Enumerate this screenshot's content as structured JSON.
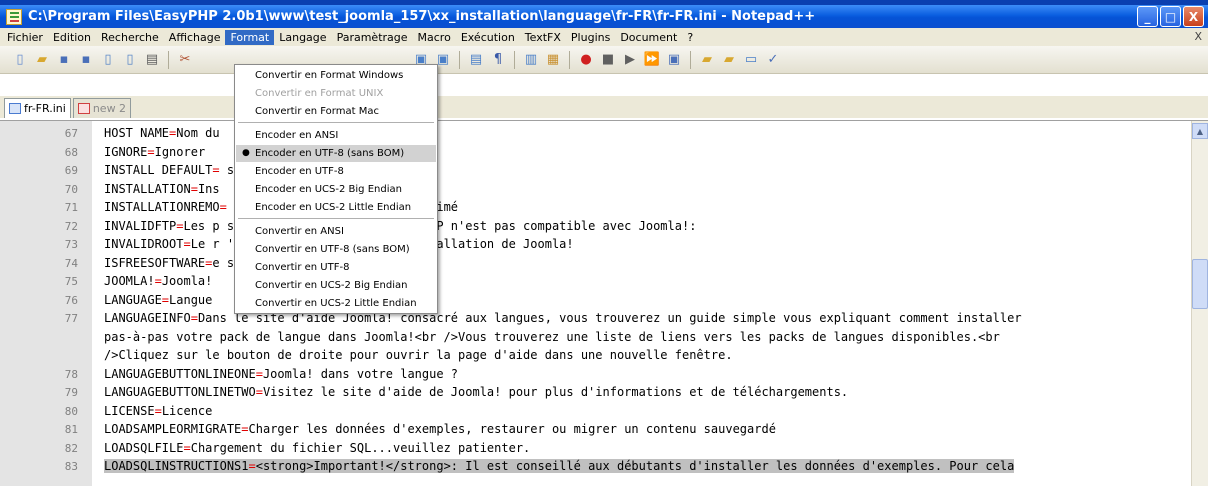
{
  "window": {
    "title": "C:\\Program Files\\EasyPHP 2.0b1\\www\\test_joomla_157\\xx_installation\\language\\fr-FR\\fr-FR.ini - Notepad++",
    "minimize_glyph": "_",
    "maximize_glyph": "□",
    "close_glyph": "X"
  },
  "menubar": {
    "items": [
      "Fichier",
      "Edition",
      "Recherche",
      "Affichage",
      "Format",
      "Langage",
      "Paramètrage",
      "Macro",
      "Exécution",
      "TextFX",
      "Plugins",
      "Document",
      "?"
    ],
    "active": "Format",
    "close_doc": "X"
  },
  "tabs": [
    {
      "label": "fr-FR.ini",
      "active": true
    },
    {
      "label": "new 2",
      "active": false
    }
  ],
  "format_menu": {
    "items": [
      {
        "label": "Convertir en Format Windows",
        "state": "normal"
      },
      {
        "label": "Convertir en Format UNIX",
        "state": "disabled"
      },
      {
        "label": "Convertir en Format Mac",
        "state": "normal"
      },
      {
        "label": "Encoder en ANSI",
        "state": "normal"
      },
      {
        "label": "Encoder en UTF-8 (sans BOM)",
        "state": "checked"
      },
      {
        "label": "Encoder en UTF-8",
        "state": "normal"
      },
      {
        "label": "Encoder en UCS-2 Big Endian",
        "state": "normal"
      },
      {
        "label": "Encoder en UCS-2 Little Endian",
        "state": "normal"
      },
      {
        "label": "Convertir en ANSI",
        "state": "normal"
      },
      {
        "label": "Convertir en UTF-8 (sans BOM)",
        "state": "normal"
      },
      {
        "label": "Convertir en UTF-8",
        "state": "normal"
      },
      {
        "label": "Convertir en UCS-2 Big Endian",
        "state": "normal"
      },
      {
        "label": "Convertir en UCS-2 Little Endian",
        "state": "normal"
      }
    ]
  },
  "editor": {
    "lines": [
      {
        "num": "67",
        "key": "HOST NAME",
        "value": "Nom du"
      },
      {
        "num": "68",
        "key": "IGNORE",
        "value": "Ignorer"
      },
      {
        "num": "69",
        "key": "INSTALL DEFAULT",
        "value": "                     s données d'exemples"
      },
      {
        "num": "70",
        "key": "INSTALLATION",
        "value": "Ins"
      },
      {
        "num": "71",
        "key": "INSTALLATIONREMO",
        "value": "                     le répertoire aura été supprimé"
      },
      {
        "num": "72",
        "key": "INVALIDFTP",
        "value": "Les p                     s valides ou votre serveur FTP n'est pas compatible avec Joomla!:"
      },
      {
        "num": "73",
        "key": "INVALIDROOT",
        "value": "Le r                      'est pas le répertoire d'installation de Joomla!"
      },
      {
        "num": "74",
        "key": "ISFREESOFTWARE",
        "value": "e                     s licence GNU/GPL v2.0."
      },
      {
        "num": "75",
        "key": "JOOMLA!",
        "value": "Joomla!"
      },
      {
        "num": "76",
        "key": "LANGUAGE",
        "value": "Langue"
      },
      {
        "num": "77",
        "key": "LANGUAGEINFO",
        "value": "Dans le site d'aide Joomla! consacré aux langues, vous trouverez un guide simple vous expliquant comment installer"
      },
      {
        "num": "",
        "key": "",
        "value": "pas-à-pas votre pack de langue dans Joomla!<br />Vous trouverez une liste de liens vers les packs de langues disponibles.<br"
      },
      {
        "num": "",
        "key": "",
        "value": "/>Cliquez sur le bouton de droite pour ouvrir la page d'aide dans une nouvelle fenêtre."
      },
      {
        "num": "78",
        "key": "LANGUAGEBUTTONLINEONE",
        "value": "Joomla! dans votre langue ?"
      },
      {
        "num": "79",
        "key": "LANGUAGEBUTTONLINETWO",
        "value": "Visitez le site d'aide de Joomla! pour plus d'informations et de téléchargements."
      },
      {
        "num": "80",
        "key": "LICENSE",
        "value": "Licence"
      },
      {
        "num": "81",
        "key": "LOADSAMPLEORMIGRATE",
        "value": "Charger les données d'exemples, restaurer ou migrer un contenu sauvegardé"
      },
      {
        "num": "82",
        "key": "LOADSQLFILE",
        "value": "Chargement du fichier SQL...veuillez patienter."
      },
      {
        "num": "83",
        "key": "LOADSQLINSTRUCTIONS1",
        "value": "<strong>Important!</strong>: Il est conseillé aux débutants d'installer les données d'exemples. Pour cela"
      }
    ],
    "highlighted_line": "83",
    "eq_sign": "="
  }
}
